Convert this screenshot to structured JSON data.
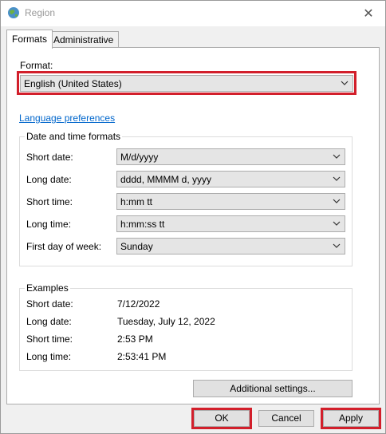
{
  "window": {
    "title": "Region",
    "close_glyph": "✕"
  },
  "tabs": [
    {
      "label": "Formats"
    },
    {
      "label": "Administrative"
    }
  ],
  "format": {
    "label": "Format:",
    "value": "English (United States)"
  },
  "language_link": "Language preferences",
  "date_time_formats": {
    "title": "Date and time formats",
    "rows": [
      {
        "label": "Short date:",
        "value": "M/d/yyyy"
      },
      {
        "label": "Long date:",
        "value": "dddd, MMMM d, yyyy"
      },
      {
        "label": "Short time:",
        "value": "h:mm tt"
      },
      {
        "label": "Long time:",
        "value": "h:mm:ss tt"
      },
      {
        "label": "First day of week:",
        "value": "Sunday"
      }
    ]
  },
  "examples": {
    "title": "Examples",
    "rows": [
      {
        "label": "Short date:",
        "value": "7/12/2022"
      },
      {
        "label": "Long date:",
        "value": "Tuesday, July 12, 2022"
      },
      {
        "label": "Short time:",
        "value": "2:53 PM"
      },
      {
        "label": "Long time:",
        "value": "2:53:41 PM"
      }
    ]
  },
  "buttons": {
    "additional": "Additional settings...",
    "ok": "OK",
    "cancel": "Cancel",
    "apply": "Apply"
  },
  "colors": {
    "highlight": "#d21f2b",
    "link": "#0066cc"
  },
  "icons": {
    "app": "globe-icon",
    "dropdown": "chevron-down-icon",
    "close": "close-icon"
  }
}
